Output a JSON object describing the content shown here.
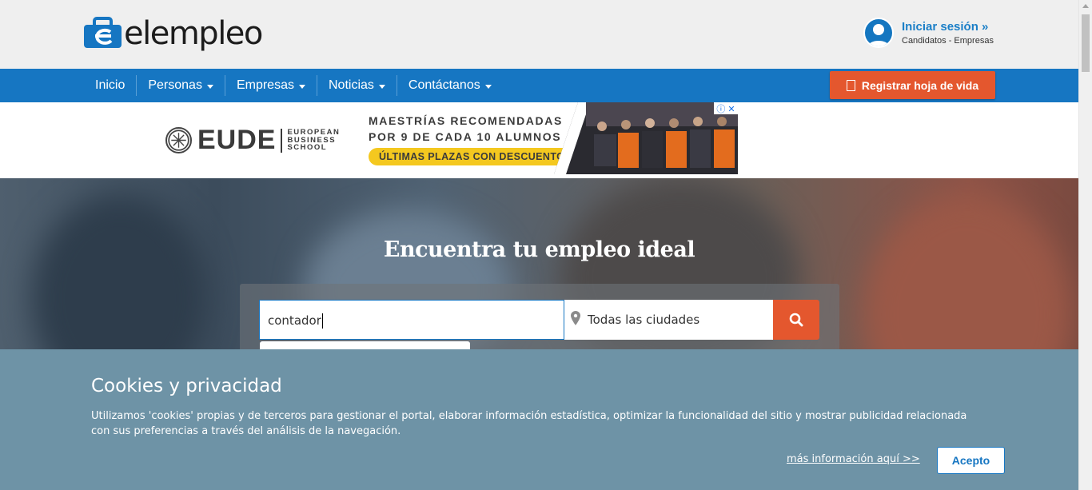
{
  "header": {
    "logo_text": "elempleo",
    "login_title": "Iniciar sesión »",
    "login_sub": "Candidatos - Empresas"
  },
  "nav": {
    "items": [
      {
        "label": "Inicio"
      },
      {
        "label": "Personas"
      },
      {
        "label": "Empresas"
      },
      {
        "label": "Noticias"
      },
      {
        "label": "Contáctanos"
      }
    ],
    "register_label": "Registrar hoja de vida"
  },
  "ad": {
    "brand": "EUDE",
    "school": [
      "EUROPEAN",
      "BUSINESS",
      "SCHOOL"
    ],
    "line1": "MAESTRÍAS RECOMENDADAS",
    "line2": "POR 9 DE CADA 10 ALUMNOS",
    "pill": "ÚLTIMAS PLAZAS CON DESCUENTO"
  },
  "hero": {
    "title": "Encuentra tu empleo ideal",
    "search_value": "contador",
    "city_value": "Todas las ciudades"
  },
  "cookie": {
    "title": "Cookies y privacidad",
    "text": "Utilizamos 'cookies' propias y de terceros para gestionar el portal, elaborar información estadística, optimizar la funcionalidad del sitio y mostrar publicidad relacionada con sus preferencias a través del análisis de la navegación.",
    "more_link": "más información aquí >>",
    "accept_label": "Acepto"
  },
  "colors": {
    "brand_blue": "#1676c2",
    "accent_orange": "#e4572e",
    "cookie_bg": "#6e93a6",
    "ad_yellow": "#f4c81f"
  }
}
